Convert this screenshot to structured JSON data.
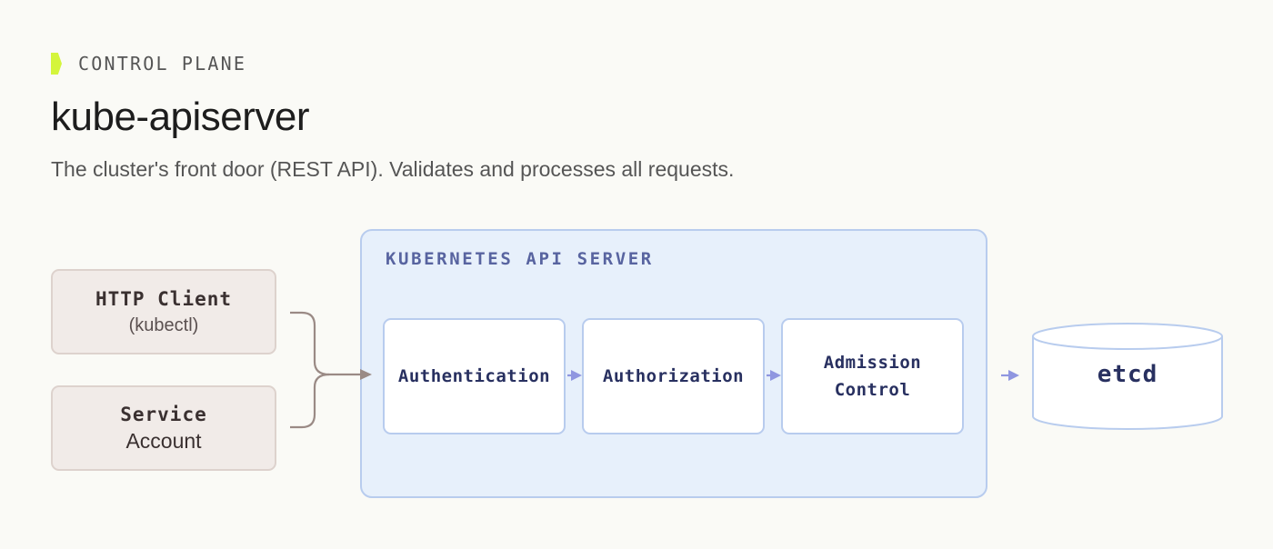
{
  "header": {
    "eyebrow": "CONTROL PLANE",
    "title": "kube-apiserver",
    "subtitle": "The cluster's front door (REST API). Validates and processes all requests."
  },
  "clients": {
    "http": {
      "name": "HTTP Client",
      "detail": "(kubectl)"
    },
    "service_account": {
      "name": "Service",
      "detail": "Account"
    }
  },
  "api_server": {
    "label": "KUBERNETES API SERVER",
    "stages": [
      "Authentication",
      "Authorization",
      "Admission Control"
    ]
  },
  "storage": {
    "label": "etcd"
  },
  "colors": {
    "accent": "#d4f53c",
    "client_fill": "#f1ebe8",
    "server_fill": "#e7f0fb",
    "server_border": "#b8ccee",
    "client_arrow": "#9a8a85",
    "flow_arrow": "#8f96e0"
  }
}
